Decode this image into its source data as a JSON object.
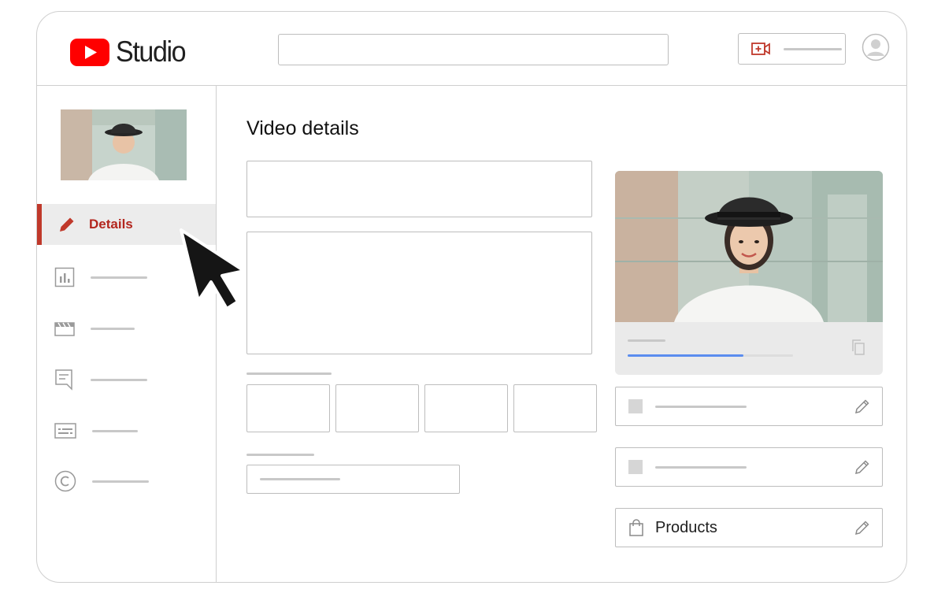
{
  "app": {
    "brand": "Studio",
    "accent_color": "#b3261e",
    "logo_red": "#ff0000"
  },
  "header": {
    "search_placeholder": "",
    "create_icon": "video-plus-icon",
    "avatar_icon": "account-circle-icon"
  },
  "sidebar": {
    "active_item": {
      "label": "Details",
      "icon": "pencil-icon"
    },
    "items": [
      {
        "icon": "analytics-icon"
      },
      {
        "icon": "editor-icon"
      },
      {
        "icon": "comments-icon"
      },
      {
        "icon": "subtitles-icon"
      },
      {
        "icon": "copyright-icon"
      }
    ]
  },
  "main": {
    "title": "Video details",
    "upload_progress": 0.7,
    "cards": [
      {
        "icon": "square-icon"
      },
      {
        "icon": "square-icon"
      },
      {
        "label": "Products",
        "icon": "shopping-bag-icon"
      }
    ]
  }
}
